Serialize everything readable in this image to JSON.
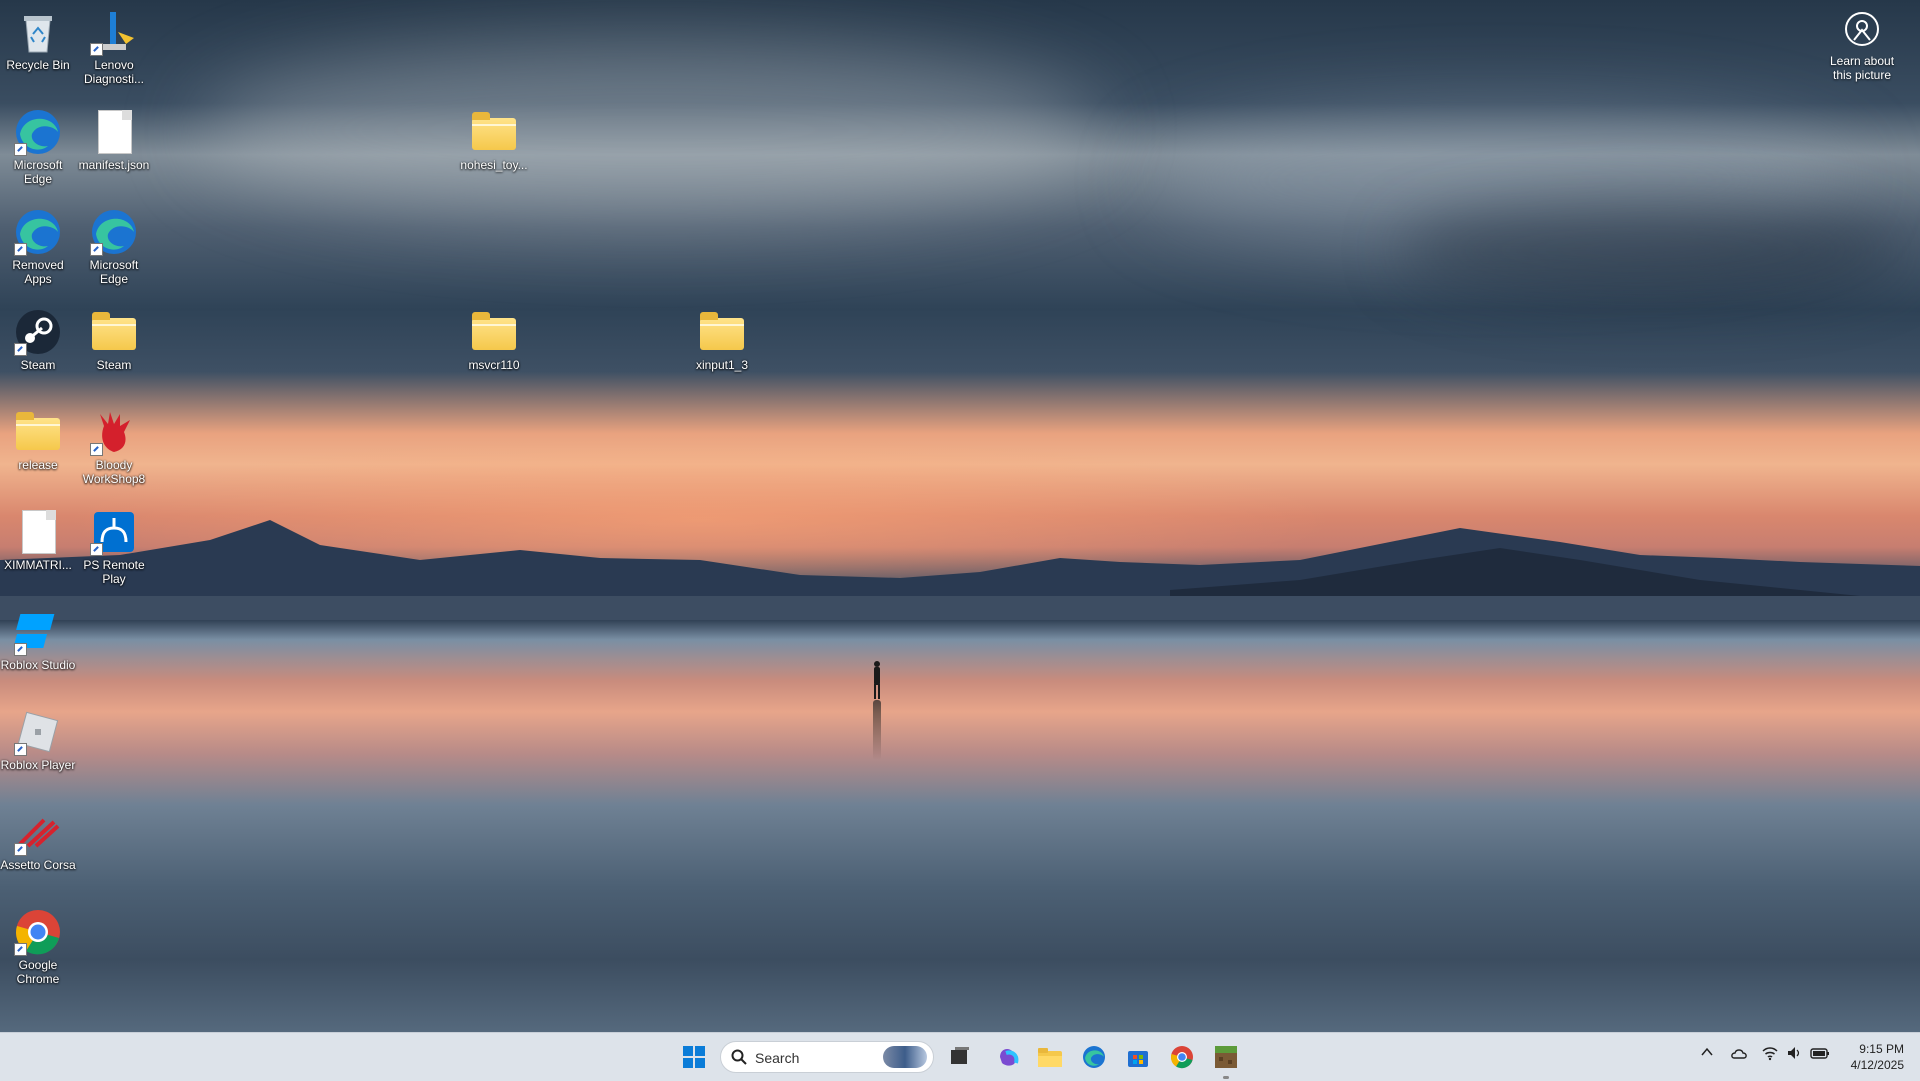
{
  "desktop": {
    "icons": [
      {
        "label": "Recycle Bin",
        "icon": "recycle-bin-icon"
      },
      {
        "label": "Lenovo Diagnosti...",
        "icon": "lenovo-diagnostics-icon"
      },
      {
        "label": "Microsoft Edge",
        "icon": "edge-icon"
      },
      {
        "label": "manifest.json",
        "icon": "document-icon"
      },
      {
        "label": "nohesi_toy...",
        "icon": "folder-icon"
      },
      {
        "label": "Removed Apps",
        "icon": "edge-icon"
      },
      {
        "label": "Microsoft Edge",
        "icon": "edge-icon"
      },
      {
        "label": "Steam",
        "icon": "steam-icon"
      },
      {
        "label": "Steam",
        "icon": "folder-icon"
      },
      {
        "label": "msvcr110",
        "icon": "folder-icon"
      },
      {
        "label": "xinput1_3",
        "icon": "folder-icon"
      },
      {
        "label": "release",
        "icon": "folder-icon"
      },
      {
        "label": "Bloody WorkShop8",
        "icon": "bloody-icon"
      },
      {
        "label": "XIMMATRI...",
        "icon": "document-icon"
      },
      {
        "label": "PS Remote Play",
        "icon": "ps-remote-play-icon"
      },
      {
        "label": "Roblox Studio",
        "icon": "roblox-studio-icon"
      },
      {
        "label": "Roblox Player",
        "icon": "roblox-player-icon"
      },
      {
        "label": "Assetto Corsa",
        "icon": "assetto-corsa-icon"
      },
      {
        "label": "Google Chrome",
        "icon": "chrome-icon"
      }
    ],
    "learn_about": "Learn about this picture"
  },
  "taskbar": {
    "search_placeholder": "Search",
    "apps": [
      "start-icon",
      "task-view-icon",
      "microsoft-365-icon",
      "file-explorer-icon",
      "edge-icon",
      "microsoft-store-icon",
      "chrome-icon",
      "minecraft-icon"
    ],
    "time": "9:15 PM",
    "date": "4/12/2025"
  },
  "colors": {
    "taskbar_bg": "#dde3ea",
    "folder": "#f5c84b",
    "edge_blue": "#1b74d1"
  }
}
